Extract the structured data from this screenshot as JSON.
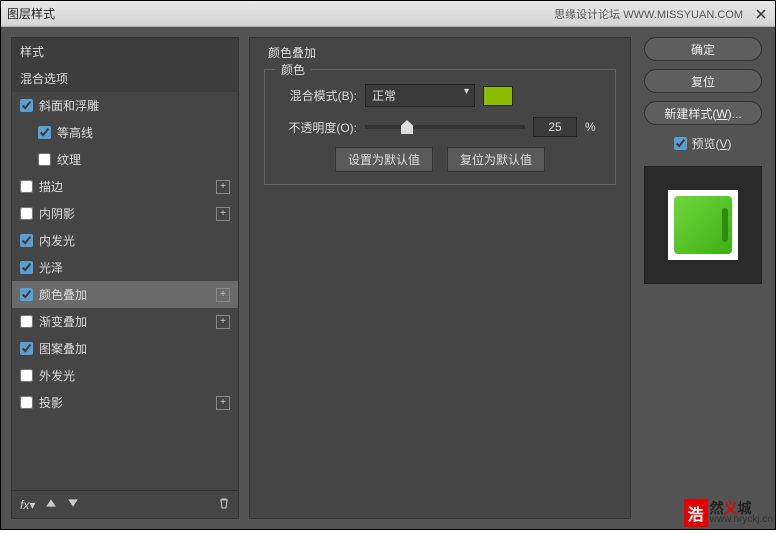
{
  "titlebar": {
    "title": "图层样式",
    "rightText": "思缘设计论坛  WWW.MISSYUAN.COM"
  },
  "left": {
    "stylesHeader": "样式",
    "blendOptions": "混合选项",
    "items": {
      "bevel": "斜面和浮雕",
      "contour": "等高线",
      "texture": "纹理",
      "stroke": "描边",
      "innerShadow": "内阴影",
      "innerGlow": "内发光",
      "satin": "光泽",
      "colorOverlay": "颜色叠加",
      "gradientOverlay": "渐变叠加",
      "patternOverlay": "图案叠加",
      "outerGlow": "外发光",
      "dropShadow": "投影"
    },
    "footer": {
      "fx": "fx"
    }
  },
  "mid": {
    "panelTitle": "颜色叠加",
    "colorGroup": "颜色",
    "blendModeLabel": "混合模式(B):",
    "blendModeValue": "正常",
    "opacityLabel": "不透明度(O):",
    "opacityValue": "25",
    "opacityUnit": "%",
    "setDefault": "设置为默认值",
    "resetDefault": "复位为默认值",
    "swatchColor": "#8bbc00"
  },
  "right": {
    "ok": "确定",
    "cancel": "复位",
    "newStyle": "新建样式(W)...",
    "preview": "预览(V)"
  },
  "watermark": {
    "badge": "浩",
    "line1a": "然",
    "line1b": "义",
    "line1c": "城",
    "url": "www.hryckj.cn"
  }
}
